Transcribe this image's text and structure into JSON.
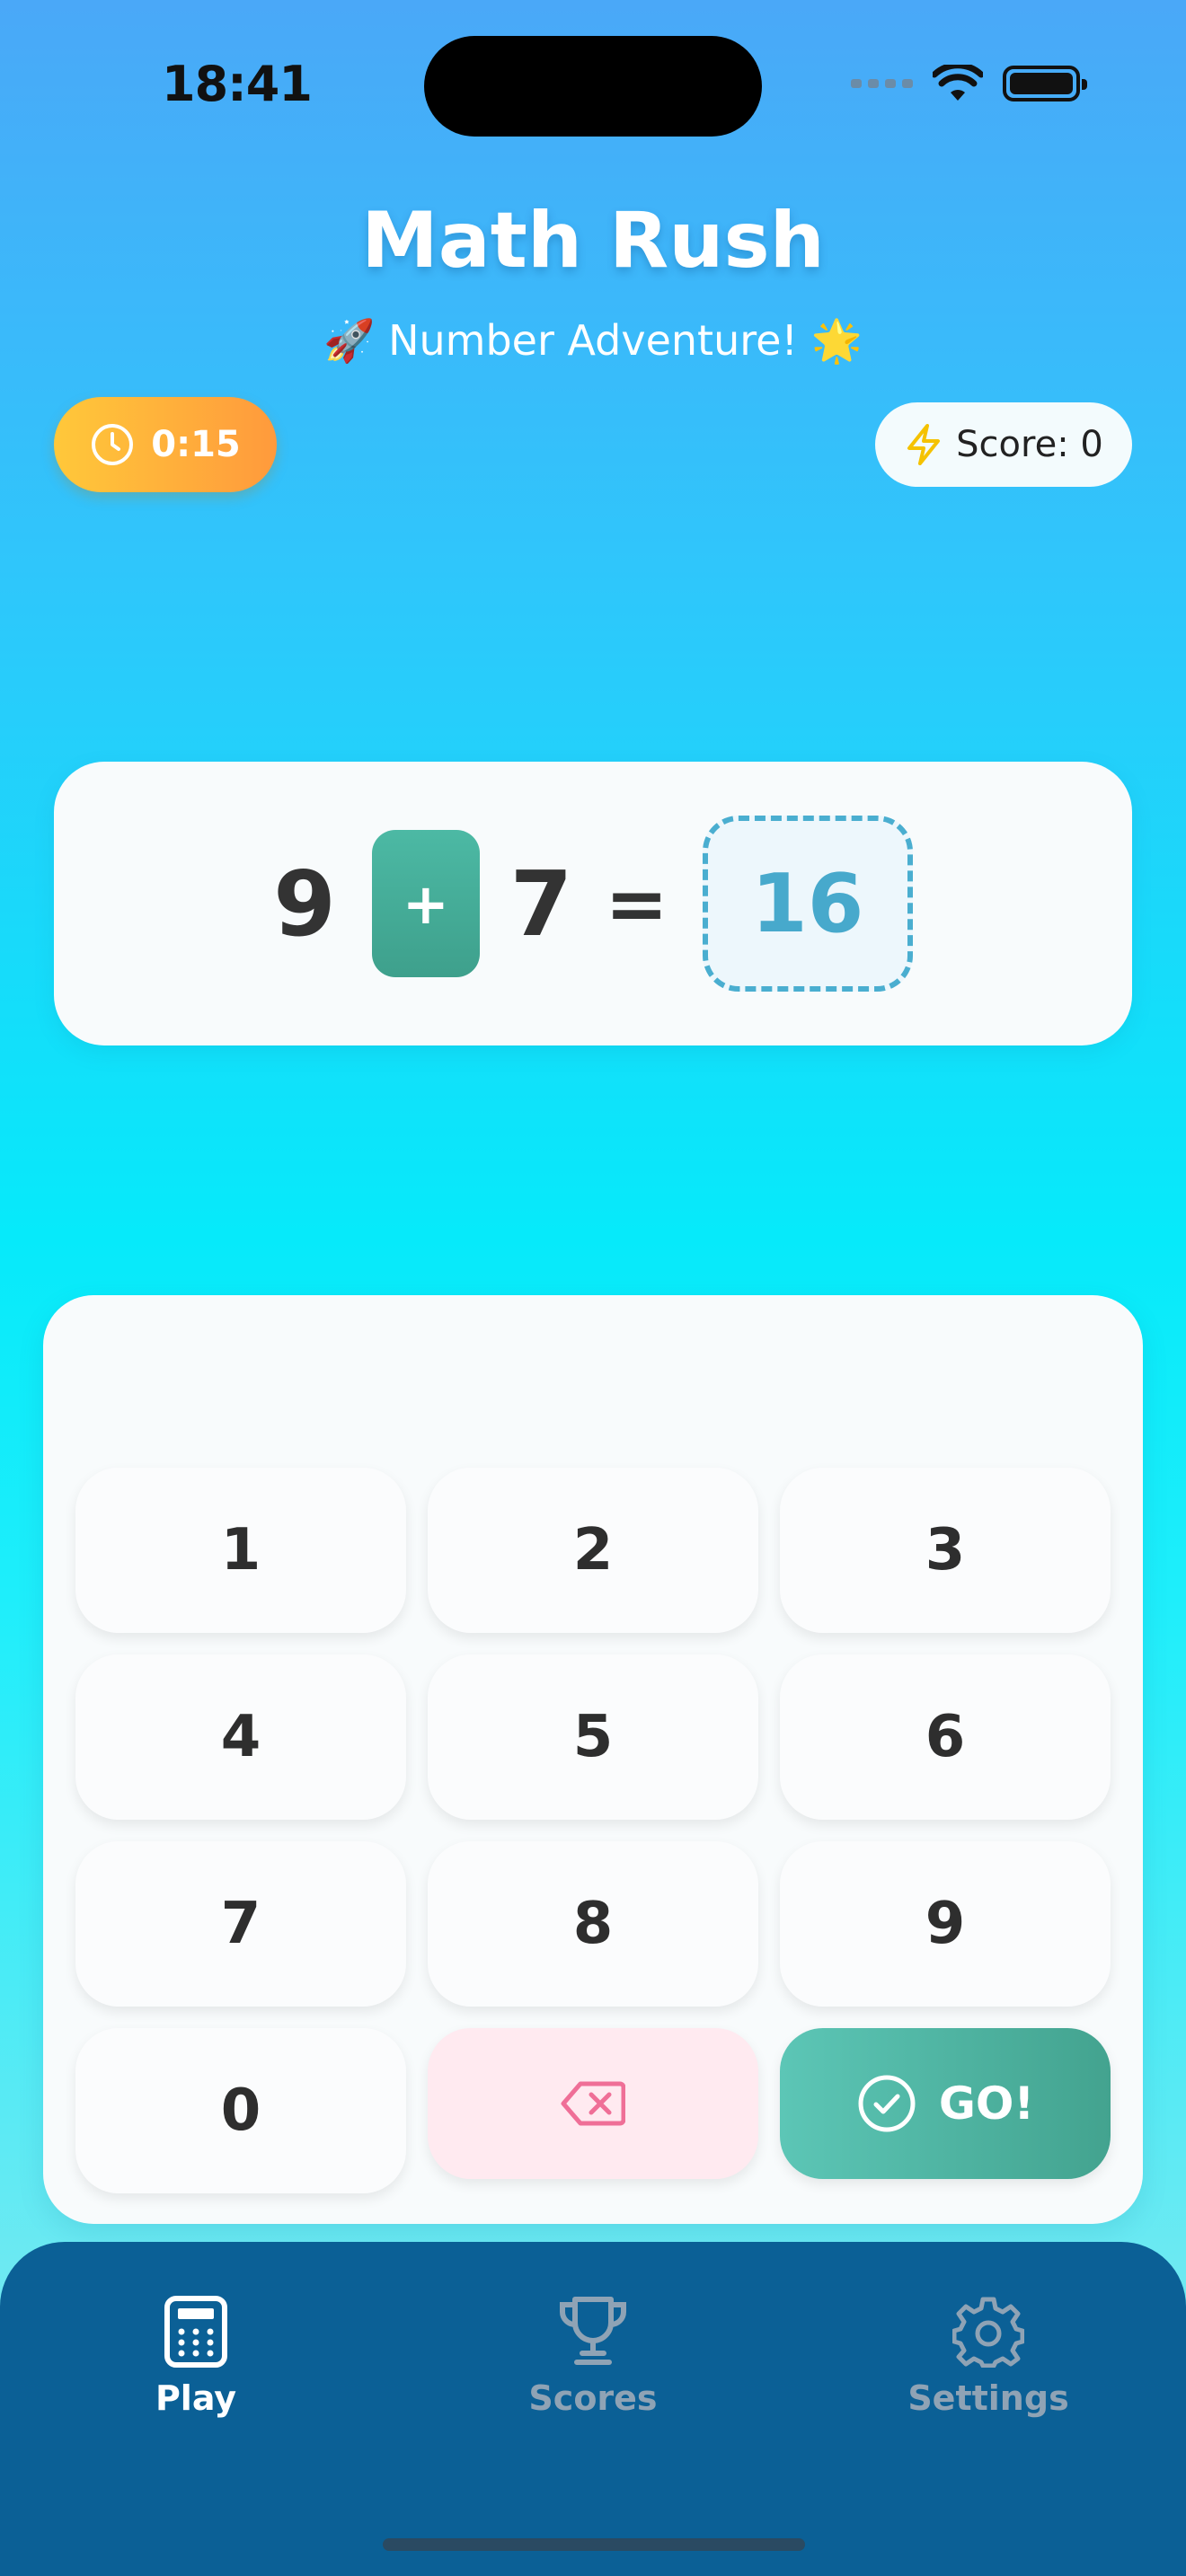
{
  "status_bar": {
    "time": "18:41",
    "icons": [
      "signal-dots-icon",
      "wifi-icon",
      "battery-icon"
    ]
  },
  "header": {
    "title": "Math Rush",
    "subtitle": "🚀 Number Adventure! 🌟"
  },
  "timer": {
    "icon": "clock-icon",
    "value": "0:15"
  },
  "score": {
    "icon": "lightning-icon",
    "label": "Score: 0"
  },
  "equation": {
    "left": "9",
    "operator": "+",
    "right": "7",
    "equals": "=",
    "answer": "16"
  },
  "keypad": {
    "keys": [
      "1",
      "2",
      "3",
      "4",
      "5",
      "6",
      "7",
      "8",
      "9",
      "0"
    ],
    "delete_icon": "backspace-icon",
    "go_label": "GO!",
    "go_icon": "check-circle-icon"
  },
  "nav": {
    "items": [
      {
        "label": "Play",
        "icon": "calculator-icon",
        "active": true
      },
      {
        "label": "Scores",
        "icon": "trophy-icon",
        "active": false
      },
      {
        "label": "Settings",
        "icon": "gear-icon",
        "active": false
      }
    ]
  },
  "colors": {
    "accent_teal": "#43a38f",
    "answer_blue": "#47a9cc",
    "timer_orange": "#ff9a3c",
    "nav_bg": "#0b6096",
    "delete_pink": "#ffeaf0"
  }
}
